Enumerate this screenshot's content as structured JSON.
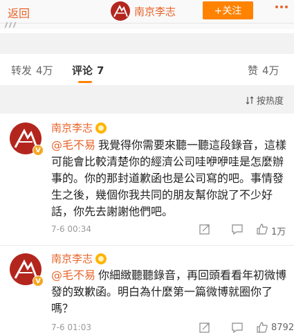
{
  "header": {
    "back_label": "返回",
    "account_name": "南京李志",
    "follow_label": "+关注",
    "more_icon": "more-dots-icon",
    "accent_color": "#e8632a",
    "follow_color": "#ff8200"
  },
  "tabs": {
    "repost": {
      "label": "转发",
      "count": "4万"
    },
    "comments": {
      "label": "评论",
      "count": "7"
    },
    "likes": {
      "label": "赞",
      "count": "4万"
    }
  },
  "sort": {
    "label": "按热度"
  },
  "comments": [
    {
      "author": "南京李志",
      "verified_badge": "V",
      "mention": "@毛不易",
      "text": "我覺得你需要來聽一聽這段錄音，這樣可能會比較清楚你的經濟公司哇咿咿哇是怎麼辦事的。你的那封道歉函也是公司寫的吧。事情發生之後，幾個你我共同的朋友幫你說了不少好話，你先去謝謝他們吧。",
      "time": "7-6 00:34",
      "likes": "1万"
    },
    {
      "author": "南京李志",
      "verified_badge": "V",
      "mention": "@毛不易",
      "text": "你細緻聽聽錄音，再回頭看看年初微博發的致歉函。明白為什麼第一篇微博就圈你了嗎？",
      "time": "7-6 01:03",
      "likes": "8792"
    }
  ]
}
